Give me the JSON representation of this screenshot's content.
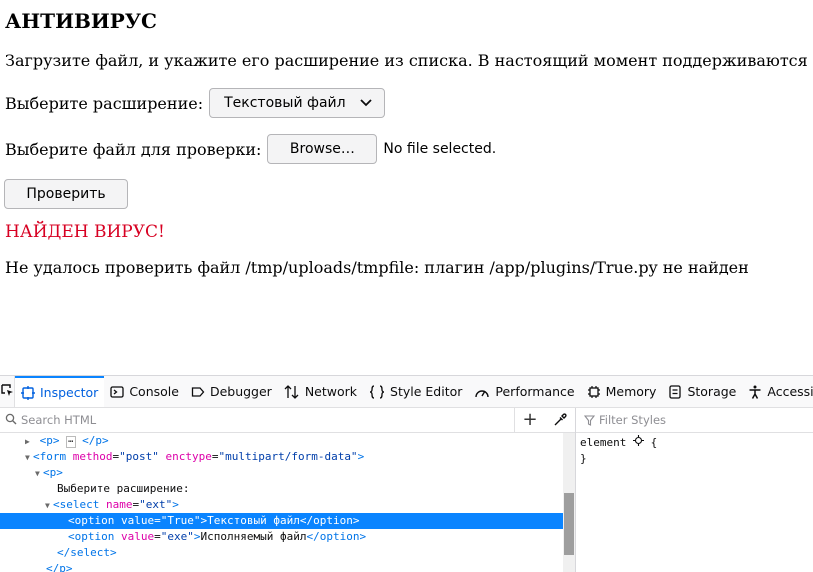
{
  "page": {
    "heading": "АНТИВИРУС",
    "description": "Загрузите файл, и укажите его расширение из списка. В настоящий момент поддерживаются след",
    "ext_label": "Выберите расширение:",
    "ext_selected": "Текстовый файл",
    "file_label": "Выберите файл для проверки:",
    "browse_label": "Browse…",
    "no_file_text": "No file selected.",
    "check_button": "Проверить",
    "virus_found": "НАЙДЕН ВИРУС!",
    "error_message": "Не удалось проверить файл /tmp/uploads/tmpfile: плагин /app/plugins/True.py не найден"
  },
  "devtools": {
    "tabs": [
      {
        "label": "Inspector",
        "icon": "inspector-icon",
        "active": true
      },
      {
        "label": "Console",
        "icon": "console-icon"
      },
      {
        "label": "Debugger",
        "icon": "debugger-icon"
      },
      {
        "label": "Network",
        "icon": "network-icon"
      },
      {
        "label": "Style Editor",
        "icon": "style-editor-icon"
      },
      {
        "label": "Performance",
        "icon": "performance-icon"
      },
      {
        "label": "Memory",
        "icon": "memory-icon"
      },
      {
        "label": "Storage",
        "icon": "storage-icon"
      },
      {
        "label": "Accessi",
        "icon": "accessibility-icon"
      }
    ],
    "search_placeholder": "Search HTML",
    "filter_placeholder": "Filter Styles",
    "tree": {
      "l1": {
        "open": "<",
        "tag": "p",
        "close": ">",
        "ellipsis": "⋯",
        "end": "</p>"
      },
      "l2": {
        "tag": "form",
        "attr1": "method",
        "val1": "\"post\"",
        "attr2": "enctype",
        "val2": "\"multipart/form-data\""
      },
      "l3": {
        "tag": "p"
      },
      "l4": {
        "text": "Выберите расширение:"
      },
      "l5": {
        "tag": "select",
        "attr1": "name",
        "val1": "\"ext\""
      },
      "l6": {
        "tag": "option",
        "attr1": "value",
        "val1": "\"True\"",
        "text": "Текстовый файл"
      },
      "l7": {
        "tag": "option",
        "attr1": "value",
        "val1": "\"exe\"",
        "text": "Исполняемый файл"
      },
      "l8": {
        "end": "</select>"
      },
      "l9": {
        "end": "</p>"
      }
    },
    "rules": {
      "selector": "element",
      "open_brace": "{",
      "close_brace": "}"
    },
    "accent": "#0a84ff"
  }
}
